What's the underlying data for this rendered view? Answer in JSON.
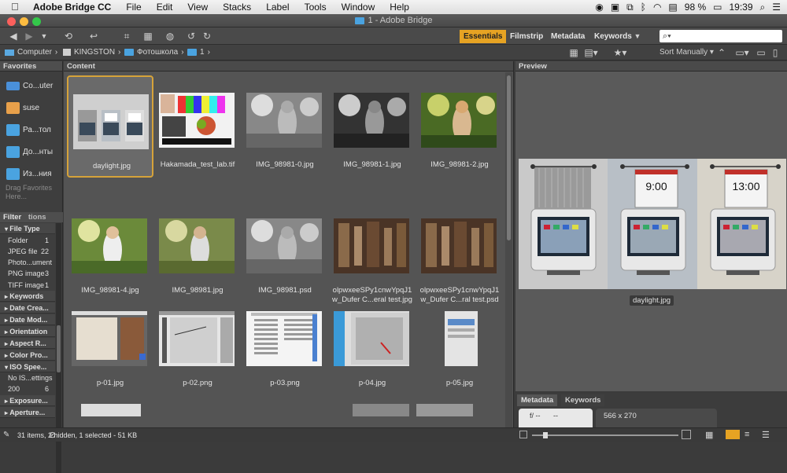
{
  "menubar": {
    "app": "Adobe Bridge CC",
    "items": [
      "File",
      "Edit",
      "View",
      "Stacks",
      "Label",
      "Tools",
      "Window",
      "Help"
    ],
    "battery": "98 %",
    "time": "19:39"
  },
  "window": {
    "title": "1 - Adobe Bridge"
  },
  "toolbar": {
    "workspaces": [
      "Essentials",
      "Filmstrip",
      "Metadata",
      "Keywords"
    ],
    "search_placeholder": "",
    "accent": "#e6a323"
  },
  "path": {
    "crumbs": [
      "Computer",
      "KINGSTON",
      "Фотошкола",
      "1"
    ],
    "sort": "Sort Manually"
  },
  "favorites": {
    "title": "Favorites",
    "items": [
      {
        "label": "Co...uter",
        "icon": "computer-icon"
      },
      {
        "label": "suse",
        "icon": "home-icon"
      },
      {
        "label": "Ра...тол",
        "icon": "folder-icon"
      },
      {
        "label": "До...нты",
        "icon": "folder-icon"
      },
      {
        "label": "Из...ния",
        "icon": "folder-icon"
      }
    ],
    "hint": "Drag Favorites Here..."
  },
  "filter": {
    "tabs": [
      "Filter",
      "tions"
    ],
    "rows": [
      {
        "label": "File Type",
        "header": true,
        "open": true
      },
      {
        "label": "Folder",
        "count": "1"
      },
      {
        "label": "JPEG file",
        "count": "22"
      },
      {
        "label": "Photo...ument",
        "count": ""
      },
      {
        "label": "PNG image",
        "count": "3"
      },
      {
        "label": "TIFF image",
        "count": "1"
      },
      {
        "label": "Keywords",
        "header": true
      },
      {
        "label": "Date Crea...",
        "header": true
      },
      {
        "label": "Date Mod...",
        "header": true
      },
      {
        "label": "Orientation",
        "header": true
      },
      {
        "label": "Aspect R...",
        "header": true
      },
      {
        "label": "Color Pro...",
        "header": true
      },
      {
        "label": "ISO Spee...",
        "header": true,
        "open": true
      },
      {
        "label": "No IS...ettings",
        "count": ""
      },
      {
        "label": "200",
        "count": "6"
      },
      {
        "label": "Exposure...",
        "header": true
      },
      {
        "label": "Aperture...",
        "header": true
      }
    ]
  },
  "content": {
    "title": "Content",
    "items": [
      {
        "label": "daylight.jpg",
        "selected": true,
        "kind": "monitors"
      },
      {
        "label": "Hakamada_test_lab.tif",
        "kind": "testchart"
      },
      {
        "label": "IMG_98981-0.jpg",
        "kind": "bw"
      },
      {
        "label": "IMG_98981-1.jpg",
        "kind": "bwdark"
      },
      {
        "label": "IMG_98981-2.jpg",
        "kind": "color"
      },
      {
        "label": "IMG_98981-4.jpg",
        "kind": "color2"
      },
      {
        "label": "IMG_98981.jpg",
        "kind": "color3"
      },
      {
        "label": "IMG_98981.psd",
        "kind": "bw"
      },
      {
        "label": "olpwxeeSPy1cnwYpqJ1\nw_Dufer C...eral test.jpg",
        "kind": "tools"
      },
      {
        "label": "olpwxeeSPy1cnwYpqJ1\nw_Dufer C...ral test.psd",
        "kind": "tools"
      },
      {
        "label": "p-01.jpg",
        "kind": "ps1"
      },
      {
        "label": "p-02.png",
        "kind": "ps2"
      },
      {
        "label": "p-03.png",
        "kind": "ps3"
      },
      {
        "label": "p-04.jpg",
        "kind": "ps4"
      },
      {
        "label": "p-05.jpg",
        "kind": "ps5"
      }
    ]
  },
  "preview": {
    "title": "Preview",
    "filename": "daylight.jpg",
    "clock1": "9:00",
    "clock2": "13:00"
  },
  "metadata": {
    "tabs": [
      "Metadata",
      "Keywords"
    ],
    "aperture": "f/ --",
    "shutter": "--",
    "dimensions": "566 x 270"
  },
  "status": {
    "text": "31 items, 2 hidden, 1 selected - 51 KB"
  }
}
